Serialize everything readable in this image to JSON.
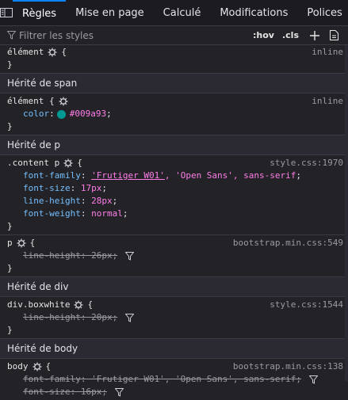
{
  "tabs": [
    {
      "label": "Règles",
      "active": true
    },
    {
      "label": "Mise en page",
      "active": false
    },
    {
      "label": "Calculé",
      "active": false
    },
    {
      "label": "Modifications",
      "active": false
    },
    {
      "label": "Polices",
      "active": false
    }
  ],
  "filter": {
    "placeholder": "Filtrer les styles",
    "hov": ":hov",
    "cls": ".cls"
  },
  "rules": {
    "r1": {
      "selector": "élément",
      "open": "{",
      "close": "}",
      "source": "inline"
    },
    "h1": "Hérité de span",
    "r2": {
      "selector": "élément {",
      "close": "}",
      "source": "inline",
      "prop": "color",
      "colon": ":",
      "value": "#009a93",
      "semi": ";",
      "swatch": "#009a93"
    },
    "h2": "Hérité de p",
    "r3": {
      "selector": ".content p",
      "open": "{",
      "close": "}",
      "source": "style.css:1970",
      "d1": {
        "prop": "font-family",
        "colon": ": ",
        "v1": "'Frutiger W01'",
        "v2": ", 'Open Sans', sans-serif",
        "semi": ";"
      },
      "d2": {
        "prop": "font-size",
        "colon": ": ",
        "value": "17px",
        "semi": ";"
      },
      "d3": {
        "prop": "line-height",
        "colon": ": ",
        "value": "28px",
        "semi": ";"
      },
      "d4": {
        "prop": "font-weight",
        "colon": ": ",
        "value": "normal",
        "semi": ";"
      }
    },
    "r4": {
      "selector": "p",
      "open": "{",
      "close": "}",
      "source": "bootstrap.min.css:549",
      "d1": {
        "text": "line-height: 26px;"
      }
    },
    "h3": "Hérité de div",
    "r5": {
      "selector": "div.boxwhite",
      "open": "{",
      "close": "}",
      "source": "style.css:1544",
      "d1": {
        "text": "line-height: 20px;"
      }
    },
    "h4": "Hérité de body",
    "r6": {
      "selector": "body",
      "open": "{",
      "source": "bootstrap.min.css:138",
      "d1": {
        "text": "font-family: 'Frutiger W01', 'Open Sans', sans-serif;"
      },
      "d2": {
        "text": "font-size: 16px;"
      }
    }
  },
  "colors": {
    "accent": "#0a84ff",
    "prop": "#75bfff",
    "value": "#ff7de9",
    "swatch": "#009a93"
  }
}
